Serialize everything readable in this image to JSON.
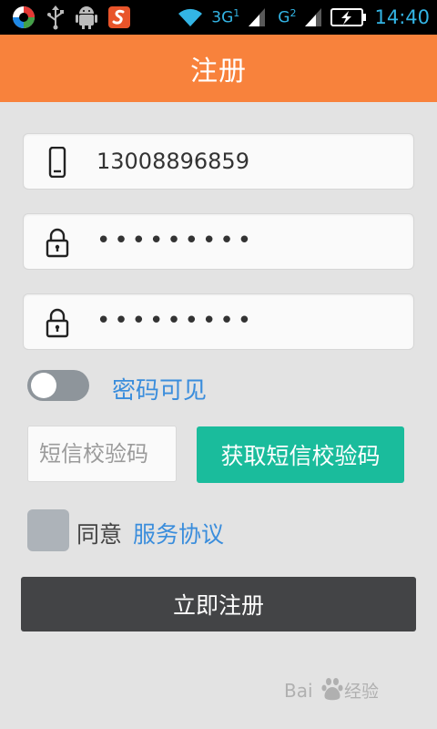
{
  "status_bar": {
    "network_3g": "3G",
    "network_3g_sim": "1",
    "network_g": "G",
    "network_g_sim": "2",
    "time": "14:40",
    "left_icons": [
      "app-icon",
      "usb-icon",
      "android-debug-icon",
      "sogou-icon"
    ],
    "right_icons": [
      "wifi-icon",
      "signal-icon",
      "signal-icon",
      "battery-charging-icon"
    ]
  },
  "header": {
    "title": "注册"
  },
  "form": {
    "phone": {
      "icon": "phone-icon",
      "value": "13008896859"
    },
    "password": {
      "icon": "lock-icon",
      "value": "•••••••••"
    },
    "confirm_password": {
      "icon": "lock-icon",
      "value": "•••••••••"
    },
    "show_password": {
      "label": "密码可见",
      "on": false
    },
    "sms_code": {
      "placeholder": "短信校验码",
      "value": ""
    },
    "get_sms_button": "获取短信校验码",
    "agree": {
      "checked": false,
      "text": "同意",
      "link": "服务协议"
    },
    "submit_button": "立即注册"
  },
  "colors": {
    "header": "#f8823c",
    "accent_green": "#1abc9c",
    "link_blue": "#3a8ddc",
    "submit_dark": "#434446",
    "background": "#e3e3e3"
  }
}
